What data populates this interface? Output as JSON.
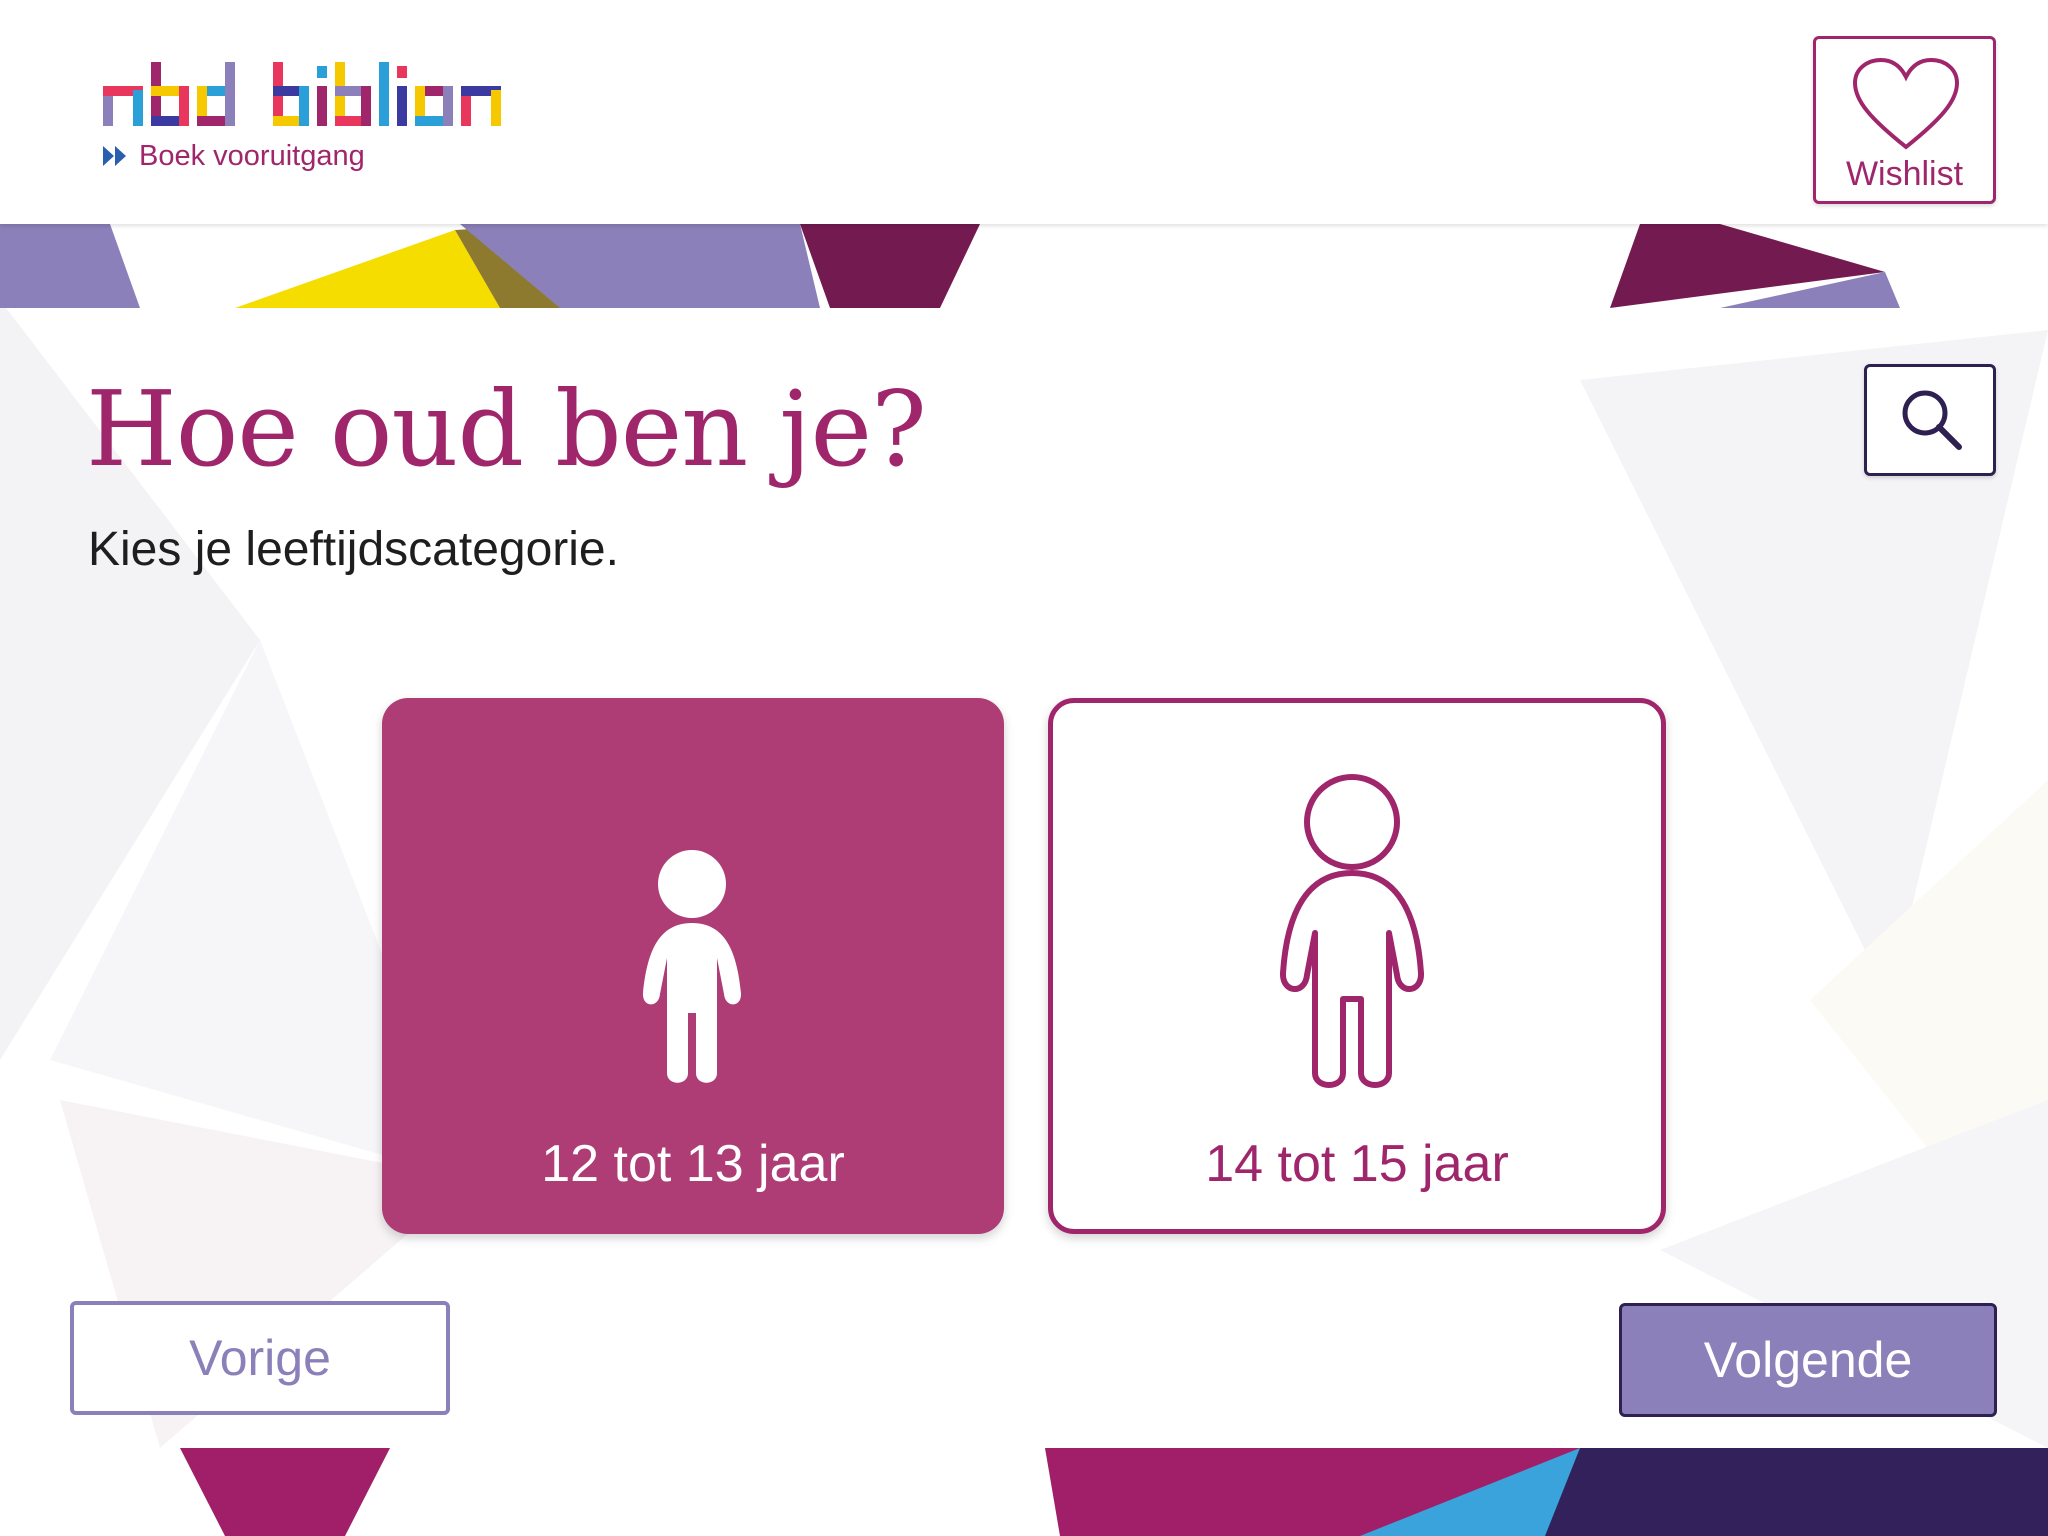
{
  "header": {
    "logo_text": "nbd biblion",
    "tagline": "Boek vooruitgang",
    "wishlist_label": "Wishlist"
  },
  "main": {
    "title": "Hoe oud ben je?",
    "subtitle": "Kies je leeftijdscategorie.",
    "age_options": [
      {
        "label": "12 tot 13 jaar",
        "selected": true
      },
      {
        "label": "14 tot 15 jaar",
        "selected": false
      }
    ]
  },
  "navigation": {
    "prev_label": "Vorige",
    "next_label": "Volgende"
  },
  "colors": {
    "brand_magenta": "#a0266c",
    "selected_card": "#ae3c75",
    "lavender": "#8b80ba",
    "navy": "#2e2050"
  },
  "icons": {
    "wishlist": "heart-icon",
    "search": "search-icon",
    "age_young": "child-icon",
    "age_older": "person-outline-icon",
    "tagline": "double-chevron-icon"
  }
}
